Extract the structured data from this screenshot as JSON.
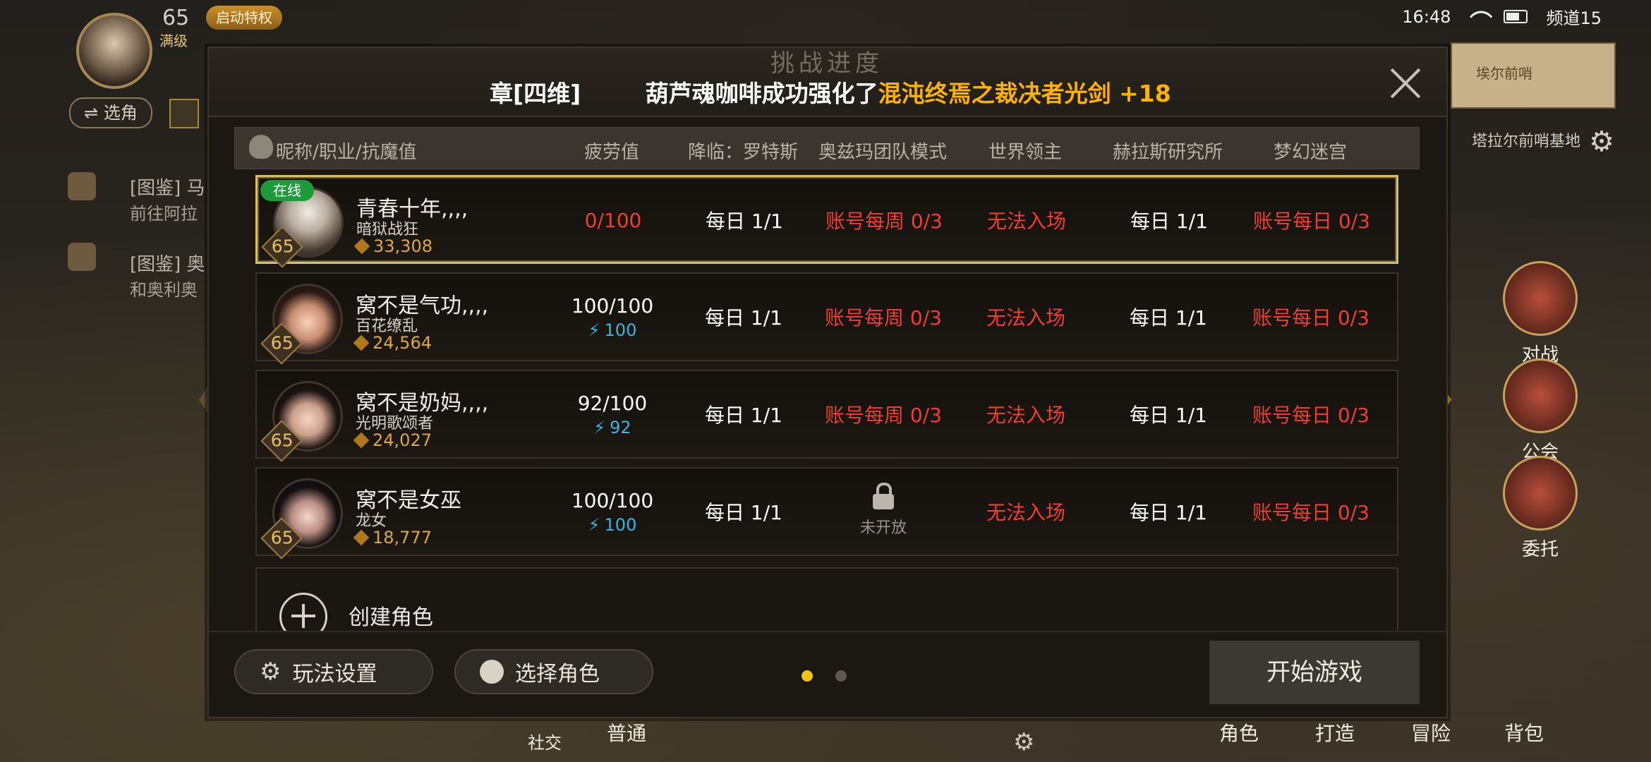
{
  "statusbar": {
    "time": "16:48",
    "channel": "频道15"
  },
  "hud": {
    "level": "65",
    "vip": "启动特权",
    "full": "满级",
    "switch_role": "⇌ 选角",
    "quests": [
      {
        "title": "[图鉴] 马",
        "sub": "前往阿拉"
      },
      {
        "title": "[图鉴] 奥",
        "sub": "和奥利奥"
      }
    ],
    "map_label": "埃尔前哨",
    "base_label": "塔拉尔前哨基地",
    "side_buttons": [
      "对战",
      "公会",
      "委托"
    ],
    "bottom_buttons": [
      "社交",
      "普通",
      "角色",
      "打造",
      "冒险",
      "背包"
    ]
  },
  "dialog": {
    "title_ghost": "挑战进度",
    "broadcast": {
      "user": "章[四维]",
      "text": "葫芦魂咖啡成功强化了",
      "item": "混沌终焉之裁决者光剑 +18"
    },
    "columns": [
      "昵称/职业/抗魔值",
      "疲劳值",
      "降临：罗特斯",
      "奥兹玛团队模式",
      "世界领主",
      "赫拉斯研究所",
      "梦幻迷宫"
    ],
    "roles": [
      {
        "online": "在线",
        "name": "青春十年,,,,",
        "job": "暗狱战狂",
        "power": "33,308",
        "level": "65",
        "fatigue": "0/100",
        "fatigue_energy": "",
        "lotus": "每日 1/1",
        "ozma": "账号每周 0/3",
        "ozma_locked": "",
        "world_boss": "无法入场",
        "helas": "每日 1/1",
        "dream": "账号每日 0/3"
      },
      {
        "online": "",
        "name": "窝不是气功,,,,",
        "job": "百花缭乱",
        "power": "24,564",
        "level": "65",
        "fatigue": "100/100",
        "fatigue_energy": "100",
        "lotus": "每日 1/1",
        "ozma": "账号每周 0/3",
        "ozma_locked": "",
        "world_boss": "无法入场",
        "helas": "每日 1/1",
        "dream": "账号每日 0/3"
      },
      {
        "online": "",
        "name": "窝不是奶妈,,,,",
        "job": "光明歌颂者",
        "power": "24,027",
        "level": "65",
        "fatigue": "92/100",
        "fatigue_energy": "92",
        "lotus": "每日 1/1",
        "ozma": "账号每周 0/3",
        "ozma_locked": "",
        "world_boss": "无法入场",
        "helas": "每日 1/1",
        "dream": "账号每日 0/3"
      },
      {
        "online": "",
        "name": "窝不是女巫",
        "job": "龙女",
        "power": "18,777",
        "level": "65",
        "fatigue": "100/100",
        "fatigue_energy": "100",
        "lotus": "每日 1/1",
        "ozma": "",
        "ozma_locked": "未开放",
        "world_boss": "无法入场",
        "helas": "每日 1/1",
        "dream": "账号每日 0/3"
      }
    ],
    "create_role": "创建角色",
    "footer": {
      "settings": "玩法设置",
      "select_role": "选择角色",
      "start": "开始游戏"
    }
  },
  "colors": {
    "accent": "#f2c21b",
    "red": "#f23d32",
    "energy": "#35b8e6",
    "online": "#1f9a3b",
    "gold": "#e2a73f"
  }
}
